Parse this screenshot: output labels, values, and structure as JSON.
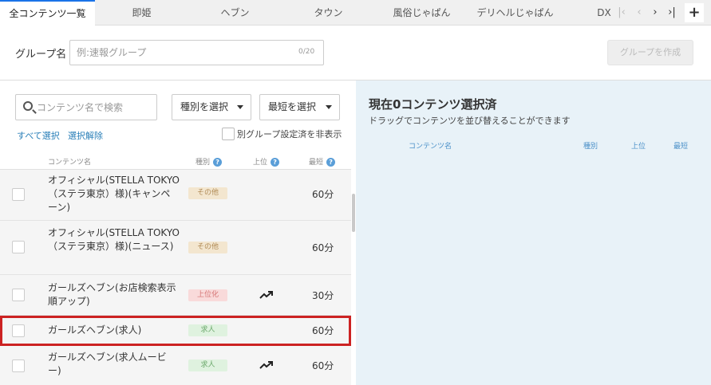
{
  "tabs": [
    {
      "label": "全コンテンツ一覧",
      "active": true
    },
    {
      "label": "即姫",
      "active": false
    },
    {
      "label": "ヘブン",
      "active": false
    },
    {
      "label": "タウン",
      "active": false
    },
    {
      "label": "風俗じゃぱん",
      "active": false
    },
    {
      "label": "デリヘルじゃぱん",
      "active": false
    },
    {
      "label": "DX",
      "active": false
    }
  ],
  "tab_nav": {
    "first": "|‹",
    "prev": "‹",
    "next": "›",
    "last": "›|",
    "add": "+"
  },
  "group": {
    "label": "グループ名",
    "placeholder": "例:速報グループ",
    "value": "",
    "counter": "0/20",
    "create_button": "グループを作成"
  },
  "filters": {
    "search_placeholder": "コンテンツ名で検索",
    "type_select": "種別を選択",
    "shortest_select": "最短を選択",
    "select_all": "すべて選択",
    "deselect": "選択解除",
    "hide_other_groups": "別グループ設定済を非表示"
  },
  "list_headers": {
    "name": "コンテンツ名",
    "type": "種別",
    "top": "上位",
    "shortest": "最短",
    "help": "?"
  },
  "rows": [
    {
      "name": "オフィシャル(STELLA TOKYO（ステラ東京）様)(キャンペーン)",
      "type": "その他",
      "type_kind": "other",
      "trend": false,
      "shortest": "60分"
    },
    {
      "name": "オフィシャル(STELLA TOKYO（ステラ東京）様)(ニュース)",
      "type": "その他",
      "type_kind": "other",
      "trend": false,
      "shortest": "60分"
    },
    {
      "name": "ガールズヘブン(お店検索表示順アップ)",
      "type": "上位化",
      "type_kind": "up",
      "trend": true,
      "shortest": "30分"
    },
    {
      "name": "ガールズヘブン(求人)",
      "type": "求人",
      "type_kind": "job",
      "trend": false,
      "shortest": "60分",
      "highlighted": true
    },
    {
      "name": "ガールズヘブン(求人ムービー)",
      "type": "求人",
      "type_kind": "job",
      "trend": true,
      "shortest": "60分"
    }
  ],
  "selected_panel": {
    "title": "現在0コンテンツ選択済",
    "subtitle": "ドラッグでコンテンツを並び替えることができます",
    "headers": {
      "name": "コンテンツ名",
      "type": "種別",
      "top": "上位",
      "shortest": "最短"
    }
  }
}
